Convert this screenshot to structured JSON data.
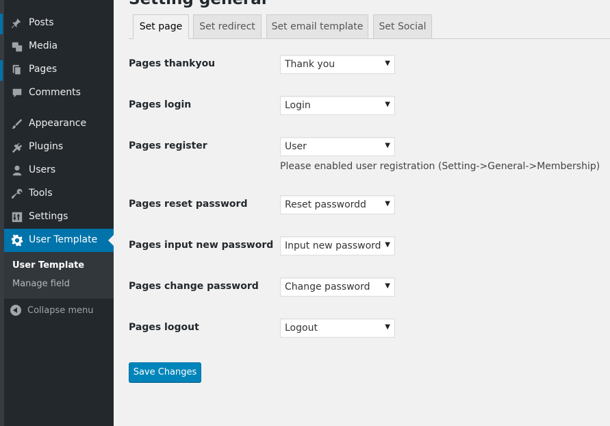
{
  "page": {
    "title": "Setting general"
  },
  "sidebar": {
    "items": [
      {
        "label": "Posts",
        "icon": "pin-icon"
      },
      {
        "label": "Media",
        "icon": "media-icon"
      },
      {
        "label": "Pages",
        "icon": "pages-icon"
      },
      {
        "label": "Comments",
        "icon": "comment-icon"
      },
      {
        "label": "Appearance",
        "icon": "brush-icon"
      },
      {
        "label": "Plugins",
        "icon": "plug-icon"
      },
      {
        "label": "Users",
        "icon": "user-icon"
      },
      {
        "label": "Tools",
        "icon": "wrench-icon"
      },
      {
        "label": "Settings",
        "icon": "settings-sliders-icon"
      },
      {
        "label": "User Template",
        "icon": "gear-icon"
      }
    ],
    "submenu": [
      {
        "label": "User Template"
      },
      {
        "label": "Manage field"
      }
    ],
    "collapse_label": "Collapse menu",
    "accent_color": "#0073aa"
  },
  "tabs": [
    {
      "label": "Set page"
    },
    {
      "label": "Set redirect"
    },
    {
      "label": "Set email template"
    },
    {
      "label": "Set Social"
    }
  ],
  "form": {
    "rows": [
      {
        "label": "Pages thankyou",
        "value": "Thank you"
      },
      {
        "label": "Pages login",
        "value": "Login"
      },
      {
        "label": "Pages register",
        "value": "User"
      },
      {
        "label": "Pages reset password",
        "value": "Reset passwordd"
      },
      {
        "label": "Pages input new password",
        "value": "Input new password"
      },
      {
        "label": "Pages change password",
        "value": "Change password"
      },
      {
        "label": "Pages logout",
        "value": "Logout"
      }
    ],
    "register_note": "Please enabled user registration (Setting->General->Membership)",
    "caret": "▼",
    "save_label": "Save Changes"
  }
}
